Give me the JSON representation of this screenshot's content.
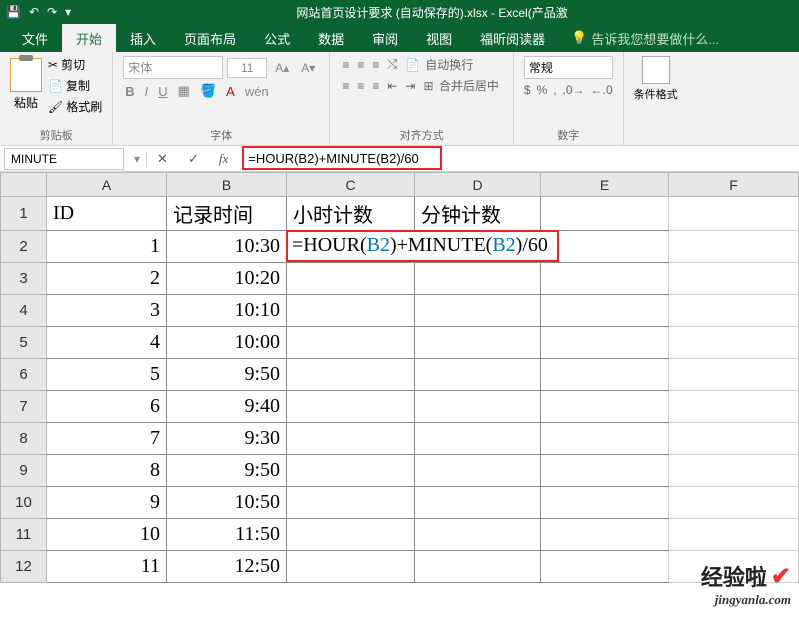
{
  "title_bar": {
    "doc_title": "网站首页设计要求 (自动保存的).xlsx - Excel(产品激",
    "qat_save": "💾",
    "qat_undo": "↶",
    "qat_redo": "↷"
  },
  "tabs": {
    "file": "文件",
    "home": "开始",
    "insert": "插入",
    "layout": "页面布局",
    "formulas": "公式",
    "data": "数据",
    "review": "审阅",
    "view": "视图",
    "foxit": "福昕阅读器",
    "tellme": "告诉我您想要做什么..."
  },
  "ribbon": {
    "clipboard": {
      "paste": "粘贴",
      "cut": "剪切",
      "copy": "复制",
      "painter": "格式刷",
      "label": "剪贴板"
    },
    "font": {
      "name": "宋体",
      "size": "11",
      "label": "字体"
    },
    "align": {
      "wrap": "自动换行",
      "merge": "合并后居中",
      "label": "对齐方式"
    },
    "number": {
      "format": "常规",
      "label": "数字"
    },
    "styles": {
      "cond": "条件格式"
    }
  },
  "formula_bar": {
    "namebox": "MINUTE",
    "formula": "=HOUR(B2)+MINUTE(B2)/60"
  },
  "headers": {
    "A": "A",
    "B": "B",
    "C": "C",
    "D": "D",
    "E": "E",
    "F": "F"
  },
  "row_headers": [
    "1",
    "2",
    "3",
    "4",
    "5",
    "6",
    "7",
    "8",
    "9",
    "10",
    "11",
    "12"
  ],
  "header_row": {
    "A": "ID",
    "B": "记录时间",
    "C": "小时计数",
    "D": "分钟计数"
  },
  "data_rows": [
    {
      "id": "1",
      "time": "10:30"
    },
    {
      "id": "2",
      "time": "10:20"
    },
    {
      "id": "3",
      "time": "10:10"
    },
    {
      "id": "4",
      "time": "10:00"
    },
    {
      "id": "5",
      "time": "9:50"
    },
    {
      "id": "6",
      "time": "9:40"
    },
    {
      "id": "7",
      "time": "9:30"
    },
    {
      "id": "8",
      "time": "9:50"
    },
    {
      "id": "9",
      "time": "10:50"
    },
    {
      "id": "10",
      "time": "11:50"
    },
    {
      "id": "11",
      "time": "12:50"
    }
  ],
  "cell_edit": {
    "prefix": "=HOUR(",
    "ref1": "B2",
    "mid": ")+MINUTE(",
    "ref2": "B2",
    "suffix": ")/60"
  },
  "watermark": {
    "big": "经验啦",
    "small": "jingyanla.com"
  }
}
